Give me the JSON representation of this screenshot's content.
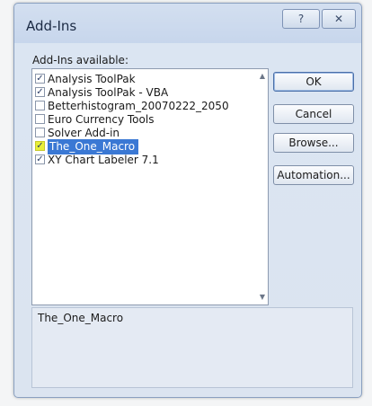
{
  "window": {
    "title": "Add-Ins",
    "help_glyph": "?",
    "close_glyph": "✕"
  },
  "list": {
    "label": "Add-Ins available:",
    "items": [
      {
        "label": "Analysis ToolPak",
        "checked": true,
        "selected": false
      },
      {
        "label": "Analysis ToolPak - VBA",
        "checked": true,
        "selected": false
      },
      {
        "label": "Betterhistogram_20070222_2050",
        "checked": false,
        "selected": false
      },
      {
        "label": "Euro Currency Tools",
        "checked": false,
        "selected": false
      },
      {
        "label": "Solver Add-in",
        "checked": false,
        "selected": false
      },
      {
        "label": "The_One_Macro",
        "checked": true,
        "selected": true
      },
      {
        "label": "XY Chart Labeler 7.1",
        "checked": true,
        "selected": false
      }
    ],
    "check_glyph": "✓",
    "scroll_up_icon": "▲",
    "scroll_down_icon": "▼"
  },
  "buttons": {
    "ok": "OK",
    "cancel": "Cancel",
    "browse": "Browse...",
    "automation": "Automation..."
  },
  "description": {
    "text": "The_One_Macro"
  },
  "colors": {
    "selection": "#3a78d4",
    "highlight": "#e8ef3a"
  }
}
